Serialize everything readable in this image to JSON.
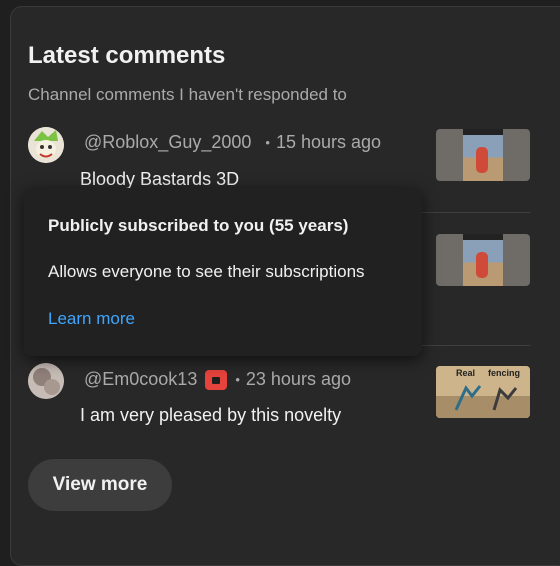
{
  "card": {
    "title": "Latest comments",
    "subtitle": "Channel comments I haven't responded to"
  },
  "comments": [
    {
      "handle": "@Roblox_Guy_2000",
      "separator": "•",
      "time": "15 hours ago",
      "text": "Bloody Bastards 3D",
      "thumbnail_icon": "video-thumbnail-icon"
    },
    {
      "thumbnail_icon": "video-thumbnail-icon"
    },
    {
      "handle": "@Em0cook13",
      "separator": "•",
      "time": "23 hours ago",
      "text": "I am very pleased by this novelty",
      "badge_icon": "member-badge-icon",
      "thumbnail_text_left": "Real",
      "thumbnail_text_right": "fencing"
    }
  ],
  "tooltip": {
    "title": "Publicly subscribed to you (55 years)",
    "description": "Allows everyone to see their subscriptions",
    "link": "Learn more"
  },
  "view_more_label": "View more",
  "colors": {
    "background": "#282828",
    "link": "#3ea6ff",
    "badge": "#e5433b"
  }
}
